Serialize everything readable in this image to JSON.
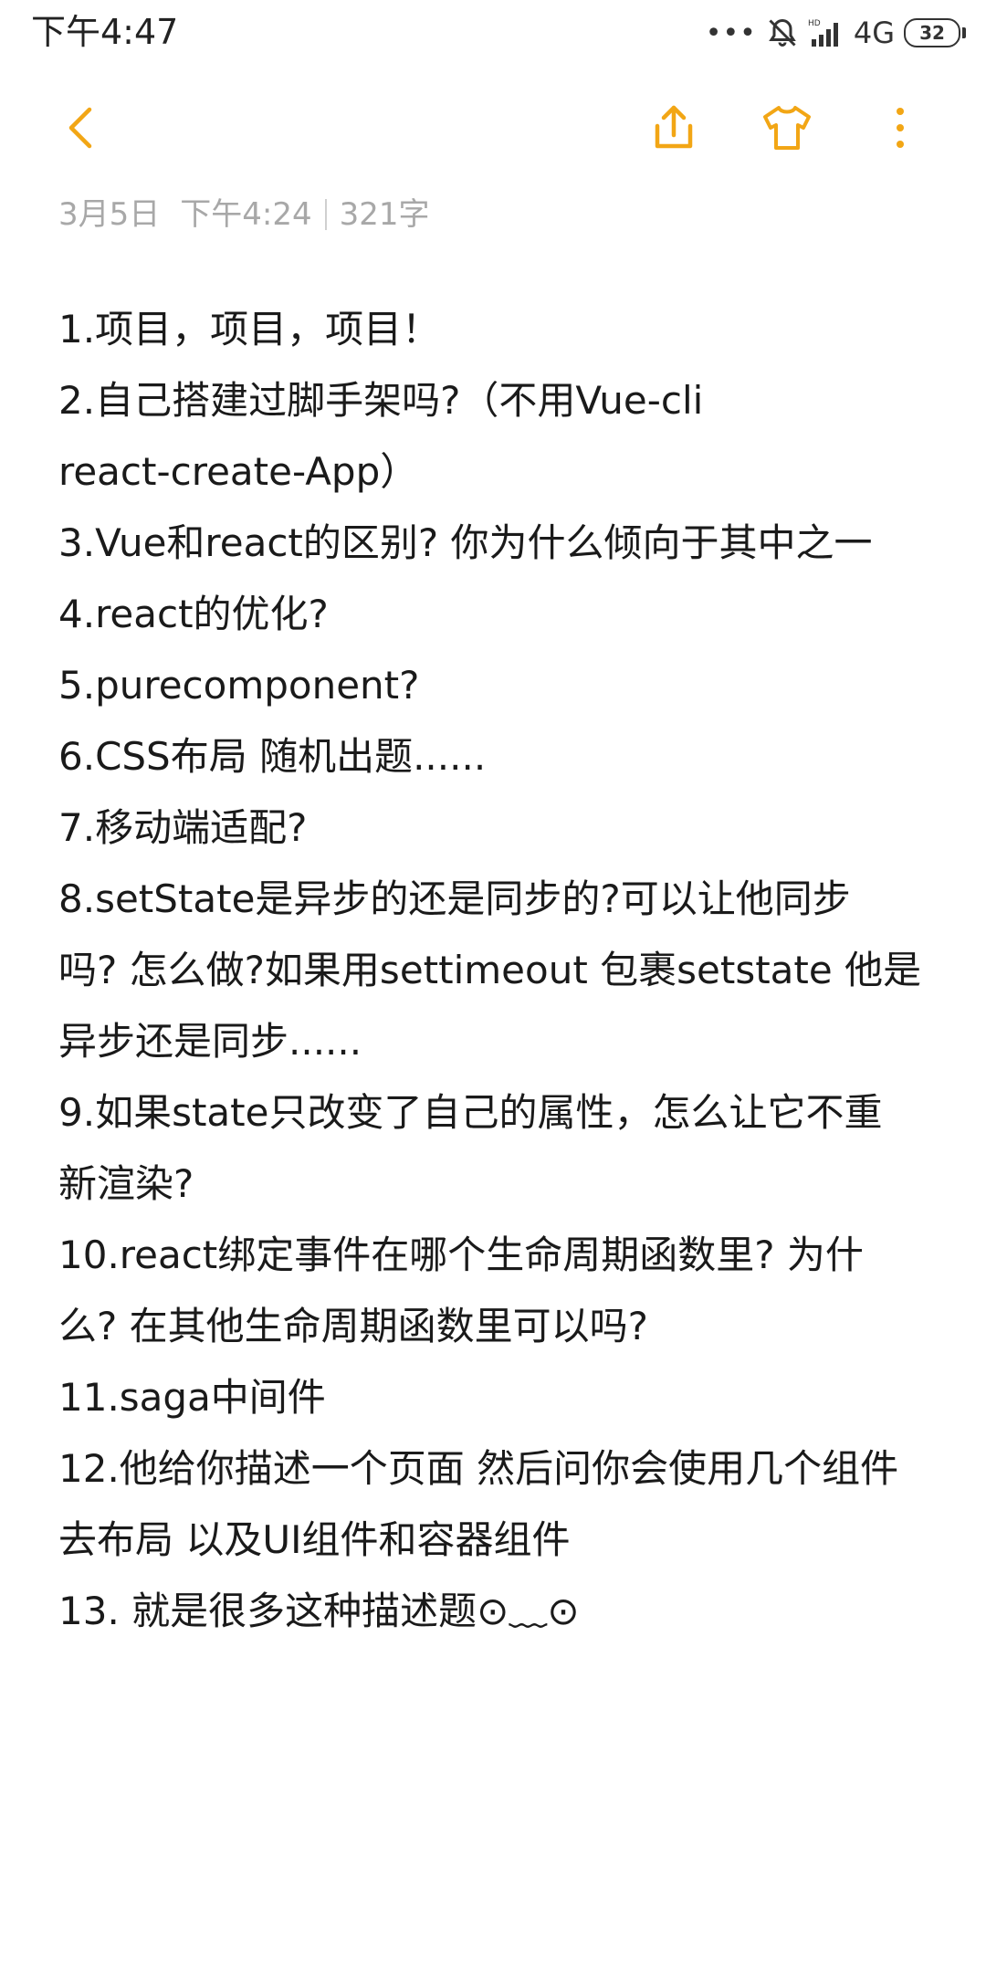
{
  "status_bar": {
    "time": "下午4:47",
    "dots": "•••",
    "network": "4G",
    "battery": "32"
  },
  "toolbar": {
    "accent_color": "#f2a615",
    "icons": [
      "back-icon",
      "share-icon",
      "theme-shirt-icon",
      "more-vertical-icon"
    ]
  },
  "meta": {
    "date": "3月5日",
    "time": "下午4:24",
    "word_count": "321字"
  },
  "note": {
    "lines": [
      "1.项目，项目，项目！",
      "2.自己搭建过脚手架吗?（不用Vue-cli",
      "react-create-App）",
      "3.Vue和react的区别? 你为什么倾向于其中之一",
      "4.react的优化?",
      "5.purecomponent?",
      "6.CSS布局 随机出题......",
      "7.移动端适配?",
      "8.setState是异步的还是同步的?可以让他同步",
      "吗? 怎么做?如果用settimeout 包裹setstate 他是",
      "异步还是同步......",
      "9.如果state只改变了自己的属性，怎么让它不重",
      "新渲染?",
      "10.react绑定事件在哪个生命周期函数里? 为什",
      "么? 在其他生命周期函数里可以吗?",
      "11.saga中间件",
      "12.他给你描述一个页面 然后问你会使用几个组件",
      "去布局  以及UI组件和容器组件",
      "13.  就是很多这种描述题⊙﹏⊙"
    ]
  }
}
